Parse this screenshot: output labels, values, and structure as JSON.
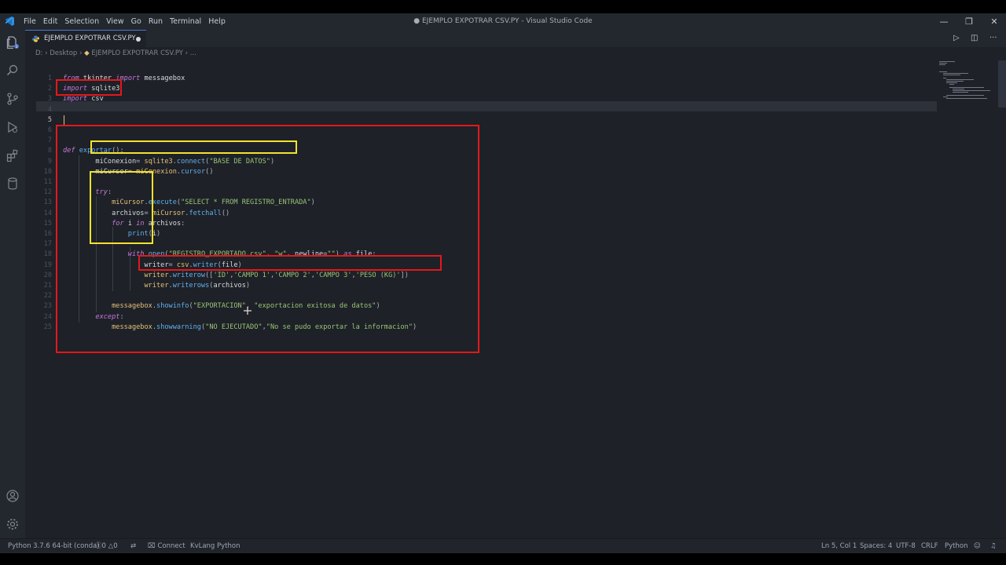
{
  "menu": [
    "File",
    "Edit",
    "Selection",
    "View",
    "Go",
    "Run",
    "Terminal",
    "Help"
  ],
  "window_title": "● EJEMPLO EXPOTRAR CSV.PY - Visual Studio Code",
  "window_controls": {
    "minimize": "—",
    "restore": "❐",
    "close": "✕"
  },
  "tab": {
    "label": "EJEMPLO EXPOTRAR CSV.PY",
    "dirty": true
  },
  "breadcrumb": {
    "drive": "D:",
    "folder": "Desktop",
    "file": "EJEMPLO EXPOTRAR CSV.PY",
    "more": "..."
  },
  "editor_actions": {
    "run": "▷",
    "split": "◫",
    "more": "···"
  },
  "line_numbers": [
    "1",
    "2",
    "3",
    "4",
    "5",
    "6",
    "7",
    "8",
    "9",
    "10",
    "11",
    "12",
    "13",
    "14",
    "15",
    "16",
    "17",
    "18",
    "19",
    "20",
    "21",
    "22",
    "23",
    "24",
    "25"
  ],
  "active_line": "5",
  "code_lines": [
    "from tkinter import messagebox",
    "import sqlite3",
    "import csv",
    "",
    "",
    "",
    "",
    "def exportar():",
    "        miConexion= sqlite3.connect(\"BASE DE DATOS\")",
    "        miCursor= miConexion.cursor()",
    "",
    "        try:",
    "            miCursor.execute(\"SELECT * FROM REGISTRO_ENTRADA\")",
    "            archivos= miCursor.fetchall()",
    "            for i in archivos:",
    "                print(i)",
    "",
    "                with open(\"REGISTRO_EXPORTADO.csv\", \"w\", newline=\"\") as file:",
    "                    writer= csv.writer(file)",
    "                    writer.writerow(['ID','CAMPO 1','CAMPO 2','CAMPO 3','PESO (KG)'])",
    "                    writer.writerows(archivos)",
    "",
    "            messagebox.showinfo(\"EXPORTACION\", \"exportacion exitosa de datos\")",
    "        except:",
    "            messagebox.showwarning(\"NO EJECUTADO\",\"No se pudo exportar la informacion\")"
  ],
  "status": {
    "interpreter": "Python 3.7.6 64-bit (conda)",
    "errors": "0",
    "warnings": "0",
    "connect": "Connect",
    "kvlang": "KvLang Python",
    "position": "Ln 5, Col 1",
    "spaces": "Spaces: 4",
    "encoding": "UTF-8",
    "eol": "CRLF",
    "language": "Python"
  },
  "colors": {
    "annotation_red": "#e3181d",
    "annotation_yellow": "#f3e22e",
    "accent": "#4d78cc"
  },
  "icons": [
    "vscode-logo-icon",
    "explorer-icon",
    "search-icon",
    "source-control-icon",
    "run-debug-icon",
    "extensions-icon",
    "database-icon",
    "account-icon",
    "settings-icon",
    "python-file-icon",
    "error-icon",
    "warning-icon",
    "sync-icon",
    "feedback-icon",
    "bell-icon"
  ]
}
